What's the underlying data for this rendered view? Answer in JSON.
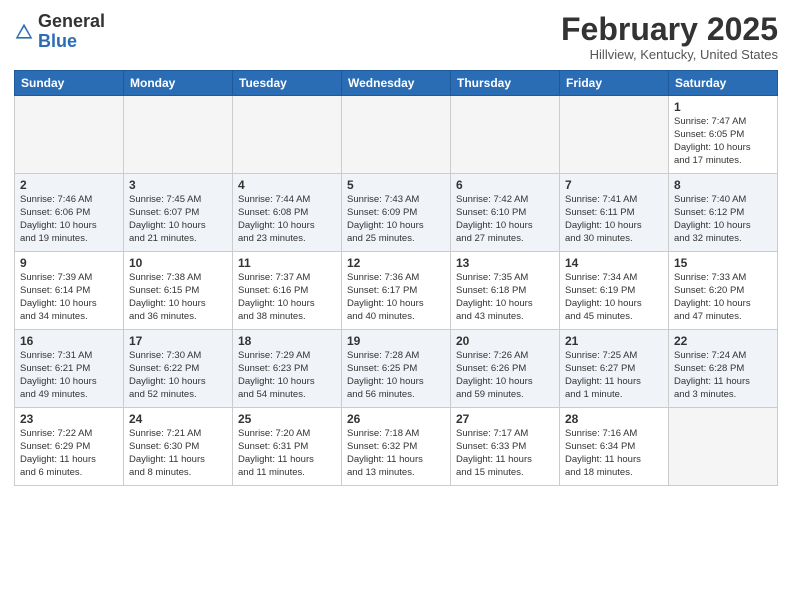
{
  "header": {
    "logo_general": "General",
    "logo_blue": "Blue",
    "month_title": "February 2025",
    "location": "Hillview, Kentucky, United States"
  },
  "days_of_week": [
    "Sunday",
    "Monday",
    "Tuesday",
    "Wednesday",
    "Thursday",
    "Friday",
    "Saturday"
  ],
  "weeks": [
    {
      "shaded": false,
      "days": [
        {
          "number": "",
          "info": "",
          "empty": true
        },
        {
          "number": "",
          "info": "",
          "empty": true
        },
        {
          "number": "",
          "info": "",
          "empty": true
        },
        {
          "number": "",
          "info": "",
          "empty": true
        },
        {
          "number": "",
          "info": "",
          "empty": true
        },
        {
          "number": "",
          "info": "",
          "empty": true
        },
        {
          "number": "1",
          "info": "Sunrise: 7:47 AM\nSunset: 6:05 PM\nDaylight: 10 hours\nand 17 minutes.",
          "empty": false
        }
      ]
    },
    {
      "shaded": true,
      "days": [
        {
          "number": "2",
          "info": "Sunrise: 7:46 AM\nSunset: 6:06 PM\nDaylight: 10 hours\nand 19 minutes.",
          "empty": false
        },
        {
          "number": "3",
          "info": "Sunrise: 7:45 AM\nSunset: 6:07 PM\nDaylight: 10 hours\nand 21 minutes.",
          "empty": false
        },
        {
          "number": "4",
          "info": "Sunrise: 7:44 AM\nSunset: 6:08 PM\nDaylight: 10 hours\nand 23 minutes.",
          "empty": false
        },
        {
          "number": "5",
          "info": "Sunrise: 7:43 AM\nSunset: 6:09 PM\nDaylight: 10 hours\nand 25 minutes.",
          "empty": false
        },
        {
          "number": "6",
          "info": "Sunrise: 7:42 AM\nSunset: 6:10 PM\nDaylight: 10 hours\nand 27 minutes.",
          "empty": false
        },
        {
          "number": "7",
          "info": "Sunrise: 7:41 AM\nSunset: 6:11 PM\nDaylight: 10 hours\nand 30 minutes.",
          "empty": false
        },
        {
          "number": "8",
          "info": "Sunrise: 7:40 AM\nSunset: 6:12 PM\nDaylight: 10 hours\nand 32 minutes.",
          "empty": false
        }
      ]
    },
    {
      "shaded": false,
      "days": [
        {
          "number": "9",
          "info": "Sunrise: 7:39 AM\nSunset: 6:14 PM\nDaylight: 10 hours\nand 34 minutes.",
          "empty": false
        },
        {
          "number": "10",
          "info": "Sunrise: 7:38 AM\nSunset: 6:15 PM\nDaylight: 10 hours\nand 36 minutes.",
          "empty": false
        },
        {
          "number": "11",
          "info": "Sunrise: 7:37 AM\nSunset: 6:16 PM\nDaylight: 10 hours\nand 38 minutes.",
          "empty": false
        },
        {
          "number": "12",
          "info": "Sunrise: 7:36 AM\nSunset: 6:17 PM\nDaylight: 10 hours\nand 40 minutes.",
          "empty": false
        },
        {
          "number": "13",
          "info": "Sunrise: 7:35 AM\nSunset: 6:18 PM\nDaylight: 10 hours\nand 43 minutes.",
          "empty": false
        },
        {
          "number": "14",
          "info": "Sunrise: 7:34 AM\nSunset: 6:19 PM\nDaylight: 10 hours\nand 45 minutes.",
          "empty": false
        },
        {
          "number": "15",
          "info": "Sunrise: 7:33 AM\nSunset: 6:20 PM\nDaylight: 10 hours\nand 47 minutes.",
          "empty": false
        }
      ]
    },
    {
      "shaded": true,
      "days": [
        {
          "number": "16",
          "info": "Sunrise: 7:31 AM\nSunset: 6:21 PM\nDaylight: 10 hours\nand 49 minutes.",
          "empty": false
        },
        {
          "number": "17",
          "info": "Sunrise: 7:30 AM\nSunset: 6:22 PM\nDaylight: 10 hours\nand 52 minutes.",
          "empty": false
        },
        {
          "number": "18",
          "info": "Sunrise: 7:29 AM\nSunset: 6:23 PM\nDaylight: 10 hours\nand 54 minutes.",
          "empty": false
        },
        {
          "number": "19",
          "info": "Sunrise: 7:28 AM\nSunset: 6:25 PM\nDaylight: 10 hours\nand 56 minutes.",
          "empty": false
        },
        {
          "number": "20",
          "info": "Sunrise: 7:26 AM\nSunset: 6:26 PM\nDaylight: 10 hours\nand 59 minutes.",
          "empty": false
        },
        {
          "number": "21",
          "info": "Sunrise: 7:25 AM\nSunset: 6:27 PM\nDaylight: 11 hours\nand 1 minute.",
          "empty": false
        },
        {
          "number": "22",
          "info": "Sunrise: 7:24 AM\nSunset: 6:28 PM\nDaylight: 11 hours\nand 3 minutes.",
          "empty": false
        }
      ]
    },
    {
      "shaded": false,
      "days": [
        {
          "number": "23",
          "info": "Sunrise: 7:22 AM\nSunset: 6:29 PM\nDaylight: 11 hours\nand 6 minutes.",
          "empty": false
        },
        {
          "number": "24",
          "info": "Sunrise: 7:21 AM\nSunset: 6:30 PM\nDaylight: 11 hours\nand 8 minutes.",
          "empty": false
        },
        {
          "number": "25",
          "info": "Sunrise: 7:20 AM\nSunset: 6:31 PM\nDaylight: 11 hours\nand 11 minutes.",
          "empty": false
        },
        {
          "number": "26",
          "info": "Sunrise: 7:18 AM\nSunset: 6:32 PM\nDaylight: 11 hours\nand 13 minutes.",
          "empty": false
        },
        {
          "number": "27",
          "info": "Sunrise: 7:17 AM\nSunset: 6:33 PM\nDaylight: 11 hours\nand 15 minutes.",
          "empty": false
        },
        {
          "number": "28",
          "info": "Sunrise: 7:16 AM\nSunset: 6:34 PM\nDaylight: 11 hours\nand 18 minutes.",
          "empty": false
        },
        {
          "number": "",
          "info": "",
          "empty": true
        }
      ]
    }
  ]
}
